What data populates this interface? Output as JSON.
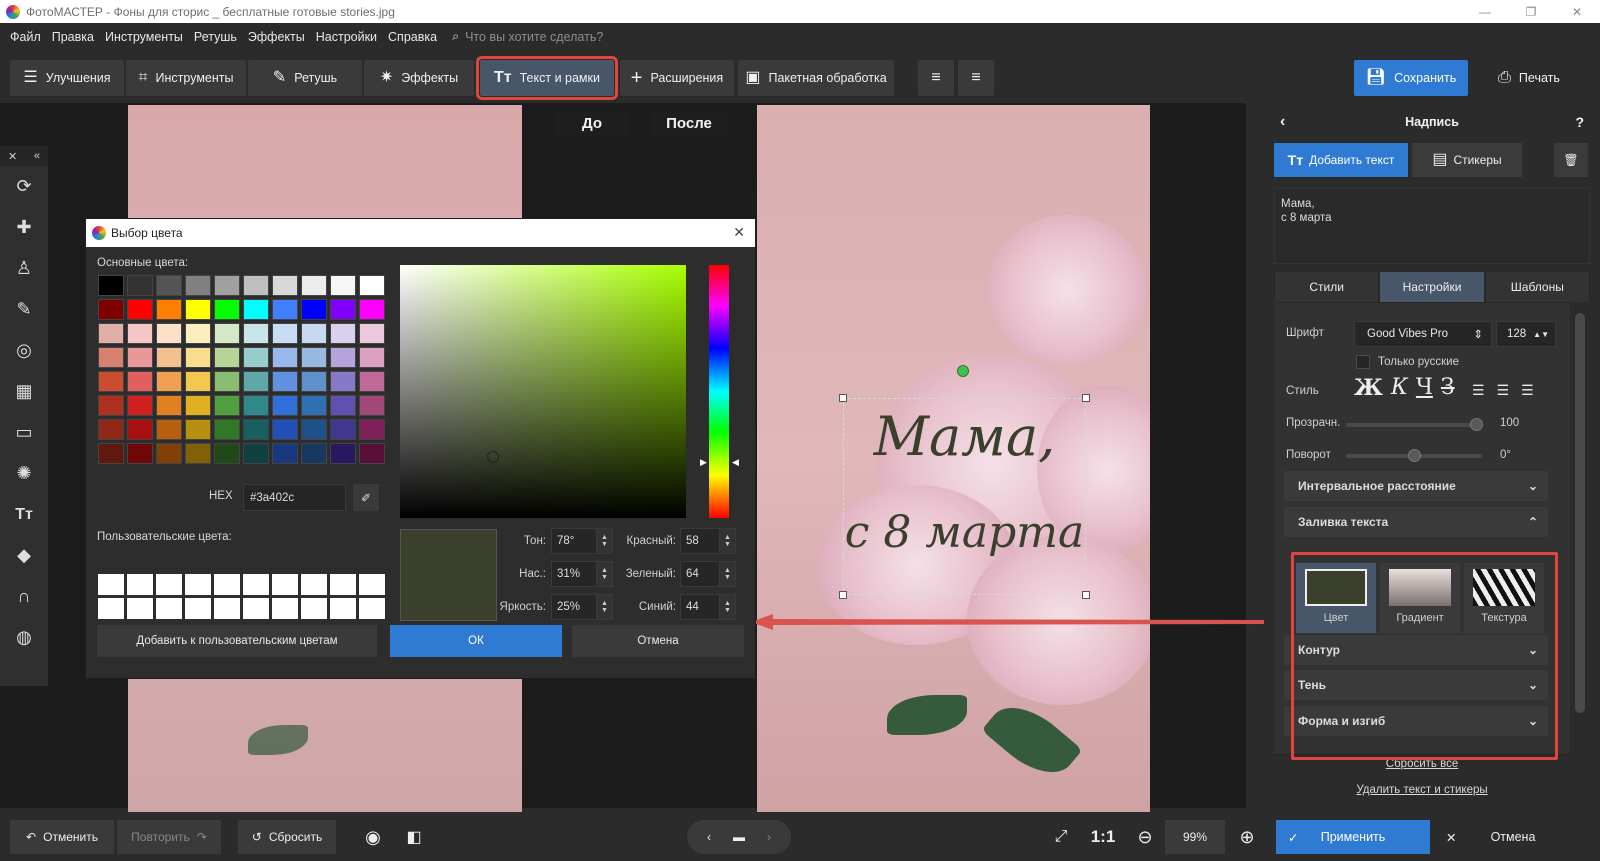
{
  "window": {
    "title": "ФотоМАСТЕР - Фоны для сторис _ бесплатные готовые stories.jpg"
  },
  "menu": {
    "items": [
      "Файл",
      "Правка",
      "Инструменты",
      "Ретушь",
      "Эффекты",
      "Настройки",
      "Справка"
    ],
    "search_placeholder": "Что вы хотите сделать?"
  },
  "toolbar": {
    "enhance": "Улучшения",
    "tools": "Инструменты",
    "retouch": "Ретушь",
    "effects": "Эффекты",
    "text_frames": "Текст и рамки",
    "extensions": "Расширения",
    "batch": "Пакетная обработка",
    "save": "Сохранить",
    "print": "Печать"
  },
  "compare": {
    "before": "До",
    "after": "После"
  },
  "canvas_text": {
    "line1": "Мама,",
    "line2": "с 8 марта",
    "color": "#3a402c"
  },
  "color_dialog": {
    "title": "Выбор цвета",
    "basic_label": "Основные цвета:",
    "custom_label": "Пользовательские цвета:",
    "hex_label": "HEX",
    "hex_value": "#3a402c",
    "hue_label": "Тон:",
    "hue_value": "78°",
    "sat_label": "Нас.:",
    "sat_value": "31%",
    "bri_label": "Яркость:",
    "bri_value": "25%",
    "red_label": "Красный:",
    "red_value": "58",
    "green_label": "Зеленый:",
    "green_value": "64",
    "blue_label": "Синий:",
    "blue_value": "44",
    "add_custom": "Добавить к пользовательским цветам",
    "ok": "ОК",
    "cancel": "Отмена",
    "swatches": [
      "#000000",
      "#333333",
      "#555555",
      "#808080",
      "#a0a0a0",
      "#bfbfbf",
      "#d8d8d8",
      "#ececec",
      "#f6f6f6",
      "#ffffff",
      "#800000",
      "#ff0000",
      "#ff8000",
      "#ffff00",
      "#00ff00",
      "#00ffff",
      "#4080ff",
      "#0000ff",
      "#8000ff",
      "#ff00ff",
      "#e0b0a8",
      "#f4c6c6",
      "#fce0c8",
      "#fdeec0",
      "#d4e8c8",
      "#c8e4e4",
      "#c8dcf4",
      "#c8d8f0",
      "#d8d0ec",
      "#ecc8dc",
      "#d88070",
      "#e89898",
      "#f4c090",
      "#f8dc90",
      "#b4d498",
      "#98ccc8",
      "#98b8ec",
      "#98b8e0",
      "#b4a4dc",
      "#dca0c0",
      "#cc4c30",
      "#e06060",
      "#f0a050",
      "#f4c850",
      "#88bc70",
      "#60a8a8",
      "#6090e0",
      "#6090cc",
      "#8878c8",
      "#c06898",
      "#b03020",
      "#d02020",
      "#e08020",
      "#e0b020",
      "#50a040",
      "#308888",
      "#3070d8",
      "#3070b0",
      "#6050b0",
      "#a04878",
      "#902818",
      "#a81010",
      "#b86010",
      "#b89010",
      "#307828",
      "#186060",
      "#2050b8",
      "#205088",
      "#403890",
      "#802058",
      "#601810",
      "#700808",
      "#804008",
      "#806008",
      "#204818",
      "#104040",
      "#183880",
      "#183860",
      "#281860",
      "#581038"
    ]
  },
  "right_panel": {
    "title": "Надпись",
    "help": "?",
    "add_text": "Добавить текст",
    "stickers": "Стикеры",
    "text_content": [
      "Мама,",
      "с 8 марта"
    ],
    "tabs": [
      "Стили",
      "Настройки",
      "Шаблоны"
    ],
    "font_label": "Шрифт",
    "font_value": "Good Vibes Pro",
    "font_size": "128",
    "only_russian": "Только русские",
    "style_label": "Стиль",
    "style_buttons": [
      "Ж",
      "К",
      "Ч",
      "З"
    ],
    "opacity_label": "Прозрачн.",
    "opacity_value": "100",
    "rotation_label": "Поворот",
    "rotation_value": "0°",
    "spacing": "Интервальное расстояние",
    "fill": "Заливка текста",
    "fill_color": "Цвет",
    "fill_gradient": "Градиент",
    "fill_texture": "Текстура",
    "contour": "Контур",
    "shadow": "Тень",
    "shape": "Форма и изгиб",
    "reset_all": "Сбросить всё",
    "delete_all": "Удалить текст и стикеры"
  },
  "bottom": {
    "undo": "Отменить",
    "redo": "Повторить",
    "reset": "Сбросить",
    "one_to_one": "1:1",
    "zoom": "99%",
    "apply": "Применить",
    "cancel": "Отмена"
  }
}
